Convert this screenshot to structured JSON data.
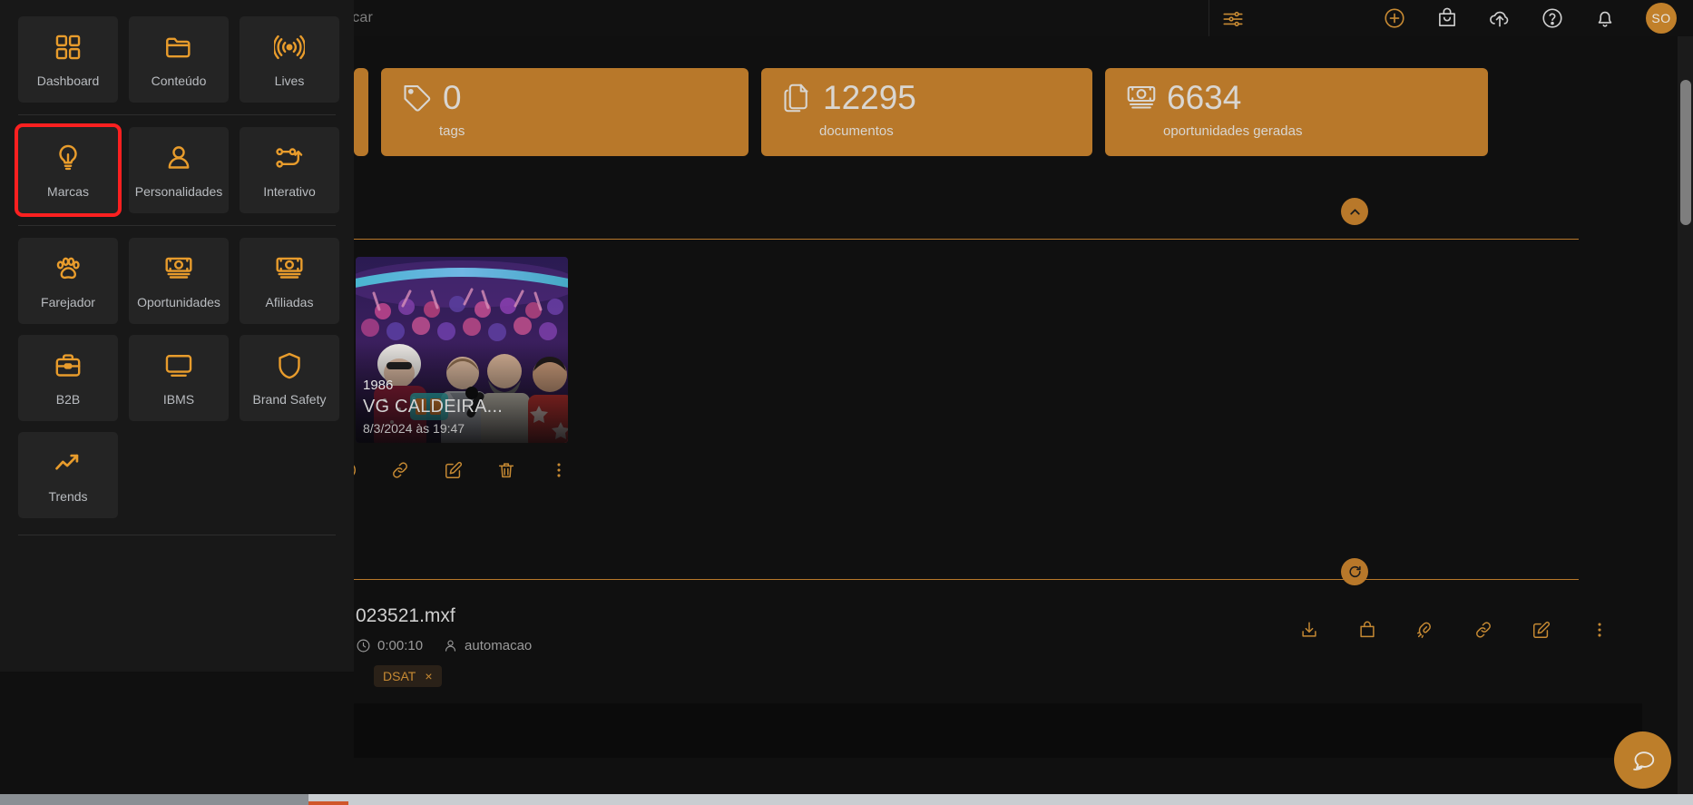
{
  "topbar": {
    "search_text": "scar",
    "icons": [
      {
        "name": "sliders-icon",
        "label": "filtros"
      },
      {
        "name": "plus-circle-icon",
        "label": "adicionar"
      },
      {
        "name": "shopping-bag-icon",
        "label": "carrinho"
      },
      {
        "name": "cloud-upload-icon",
        "label": "upload"
      },
      {
        "name": "help-circle-icon",
        "label": "ajuda"
      },
      {
        "name": "bell-icon",
        "label": "notificacoes"
      }
    ],
    "avatar_initials": "SO"
  },
  "stats": [
    {
      "icon": "tag-icon",
      "value": "0",
      "label": "tags"
    },
    {
      "icon": "documents-icon",
      "value": "12295",
      "label": "documentos"
    },
    {
      "icon": "money-icon",
      "value": "6634",
      "label": "oportunidades geradas"
    }
  ],
  "collapse_button": {
    "name": "chevron-up-icon",
    "label": "recolher"
  },
  "refresh_button": {
    "name": "refresh-icon",
    "label": "atualizar"
  },
  "video_card": {
    "year": "1986",
    "title": "VG CALDEIRA...",
    "date": "8/3/2024 às 19:47",
    "actions": [
      {
        "name": "clock-icon",
        "label": "historico"
      },
      {
        "name": "link-icon",
        "label": "link"
      },
      {
        "name": "edit-icon",
        "label": "editar"
      },
      {
        "name": "trash-icon",
        "label": "excluir"
      },
      {
        "name": "more-vertical-icon",
        "label": "mais opcoes"
      }
    ]
  },
  "file_row": {
    "name": "023521.mxf",
    "duration": "0:00:10",
    "user": "automacao",
    "tag": "DSAT",
    "tag_close": "×",
    "actions": [
      {
        "name": "download-icon",
        "label": "baixar"
      },
      {
        "name": "shopping-bag-icon",
        "label": "carrinho"
      },
      {
        "name": "magnet-icon",
        "label": "similares"
      },
      {
        "name": "link-icon",
        "label": "link"
      },
      {
        "name": "edit-icon",
        "label": "editar"
      },
      {
        "name": "more-vertical-icon",
        "label": "mais opcoes"
      }
    ]
  },
  "chat_button": {
    "name": "chat-icon",
    "label": "suporte"
  },
  "menu": {
    "group1": [
      {
        "icon": "grid-icon",
        "label": "Dashboard",
        "selected": false
      },
      {
        "icon": "folder-icon",
        "label": "Conteúdo",
        "selected": false
      },
      {
        "icon": "broadcast-icon",
        "label": "Lives",
        "selected": false
      }
    ],
    "group2": [
      {
        "icon": "lightbulb-icon",
        "label": "Marcas",
        "selected": true
      },
      {
        "icon": "person-icon",
        "label": "Personalidades",
        "selected": false
      },
      {
        "icon": "nodes-icon",
        "label": "Interativo",
        "selected": false
      }
    ],
    "group3": [
      {
        "icon": "paw-icon",
        "label": "Farejador",
        "selected": false
      },
      {
        "icon": "money-icon",
        "label": "Oportunidades",
        "selected": false
      },
      {
        "icon": "money-icon",
        "label": "Afiliadas",
        "selected": false
      },
      {
        "icon": "briefcase-icon",
        "label": "B2B",
        "selected": false
      },
      {
        "icon": "monitor-icon",
        "label": "IBMS",
        "selected": false
      },
      {
        "icon": "shield-icon",
        "label": "Brand Safety",
        "selected": false
      },
      {
        "icon": "trending-up-icon",
        "label": "Trends",
        "selected": false
      }
    ]
  },
  "colors": {
    "accent": "#e89c2c",
    "card": "#b8782a",
    "highlight": "#fb2020",
    "background": "#101010",
    "panel": "#181818",
    "tile": "#242424"
  }
}
